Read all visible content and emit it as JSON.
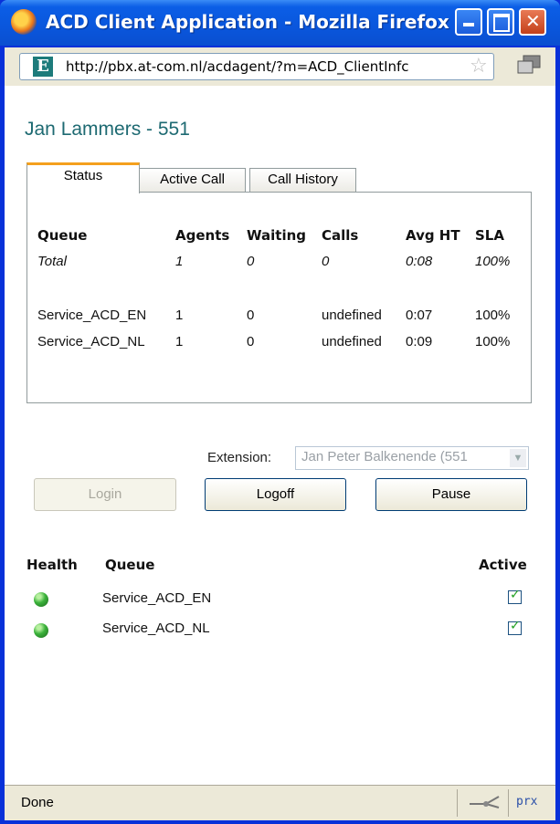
{
  "window": {
    "title": "ACD Client Application - Mozilla Firefox"
  },
  "address_bar": {
    "url": "http://pbx.at-com.nl/acdagent/?m=ACD_ClientInfc",
    "site_icon_letter": "E"
  },
  "page": {
    "title": "Jan Lammers - 551",
    "tabs": [
      "Status",
      "Active Call",
      "Call History"
    ],
    "status_table": {
      "headers": [
        "Queue",
        "Agents",
        "Waiting",
        "Calls",
        "Avg HT",
        "SLA"
      ],
      "total": [
        "Total",
        "1",
        "0",
        "0",
        "0:08",
        "100%"
      ],
      "rows": [
        [
          "Service_ACD_EN",
          "1",
          "0",
          "undefined",
          "0:07",
          "100%"
        ],
        [
          "Service_ACD_NL",
          "1",
          "0",
          "undefined",
          "0:09",
          "100%"
        ]
      ]
    },
    "extension": {
      "label": "Extension:",
      "value": "Jan Peter Balkenende (551"
    },
    "buttons": {
      "login": "Login",
      "logoff": "Logoff",
      "pause": "Pause"
    },
    "queue_list": {
      "headers": {
        "health": "Health",
        "queue": "Queue",
        "active": "Active"
      },
      "rows": [
        {
          "name": "Service_ACD_EN",
          "health": "green",
          "active": true
        },
        {
          "name": "Service_ACD_NL",
          "health": "green",
          "active": true
        }
      ]
    }
  },
  "statusbar": {
    "text": "Done",
    "proxy_label": "prx"
  },
  "colors": {
    "title_text": "#1e6a72",
    "tab_active_accent": "#f4a01d",
    "titlebar_blue": "#0a56dc"
  }
}
